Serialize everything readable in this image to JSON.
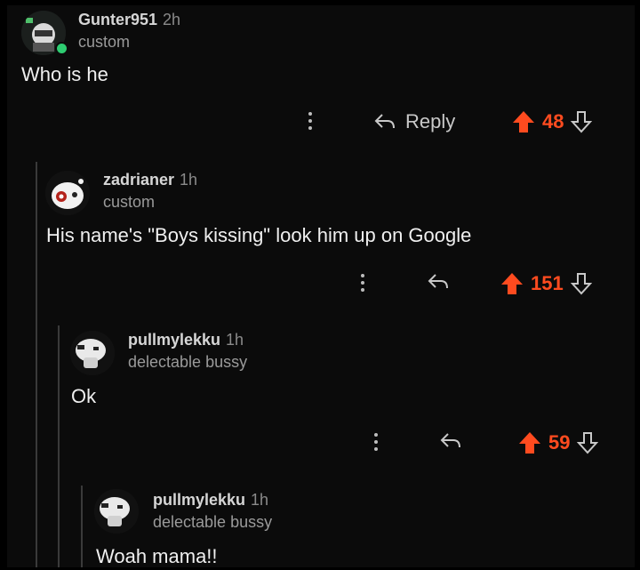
{
  "accent": "#ff4b1f",
  "comments": [
    {
      "username": "Gunter951",
      "time": "2h",
      "flair": "custom",
      "body": "Who is he",
      "reply_label": "Reply",
      "score": "48",
      "avatar_icon": "gunter-avatar-icon"
    },
    {
      "username": "zadrianer",
      "time": "1h",
      "flair": "custom",
      "body": "His name's \"Boys kissing\" look him up on Google",
      "reply_label": "",
      "score": "151",
      "avatar_icon": "zadrianer-avatar-icon"
    },
    {
      "username": "pullmylekku",
      "time": "1h",
      "flair": "delectable bussy",
      "body": "Ok",
      "reply_label": "",
      "score": "59",
      "avatar_icon": "pullmylekku-avatar-icon"
    },
    {
      "username": "pullmylekku",
      "time": "1h",
      "flair": "delectable bussy",
      "body": "Woah mama!!",
      "reply_label": "",
      "score": "",
      "avatar_icon": "pullmylekku-avatar-icon"
    }
  ]
}
